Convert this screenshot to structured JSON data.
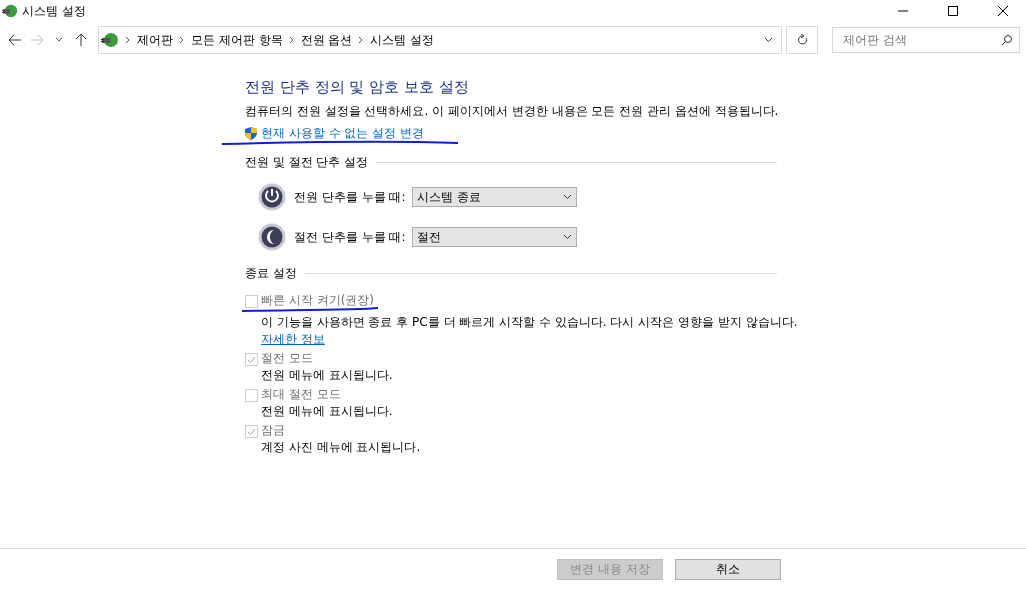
{
  "window": {
    "title": "시스템 설정"
  },
  "breadcrumb": [
    "제어판",
    "모든 제어판 항목",
    "전원 옵션",
    "시스템 설정"
  ],
  "search": {
    "placeholder": "제어판 검색"
  },
  "heading": "전원 단추 정의 및 암호 보호 설정",
  "intro": "컴퓨터의 전원 설정을 선택하세요. 이 페이지에서 변경한 내용은 모든 전원 관리 옵션에 적용됩니다.",
  "admin_link": "현재 사용할 수 없는 설정 변경",
  "buttons_section": {
    "title": "전원 및 절전 단추 설정",
    "rows": [
      {
        "kind": "power",
        "label": "전원 단추를 누를 때:",
        "value": "시스템 종료"
      },
      {
        "kind": "sleep",
        "label": "절전 단추를 누를 때:",
        "value": "절전"
      }
    ]
  },
  "shutdown_section": {
    "title": "종료 설정",
    "options": [
      {
        "label": "빠른 시작 켜기(권장)",
        "checked": false,
        "disabled": true,
        "description": "이 기능을 사용하면 종료 후 PC를 더 빠르게 시작할 수 있습니다. 다시 시작은 영향을 받지 않습니다.",
        "link": "자세한 정보"
      },
      {
        "label": "절전 모드",
        "checked": true,
        "disabled": true,
        "description": "전원 메뉴에 표시됩니다."
      },
      {
        "label": "최대 절전 모드",
        "checked": false,
        "disabled": true,
        "description": "전원 메뉴에 표시됩니다."
      },
      {
        "label": "잠금",
        "checked": true,
        "disabled": true,
        "description": "계정 사진 메뉴에 표시됩니다."
      }
    ]
  },
  "footer": [
    {
      "label": "변경 내용 저장",
      "disabled": true
    },
    {
      "label": "취소",
      "disabled": false
    }
  ]
}
